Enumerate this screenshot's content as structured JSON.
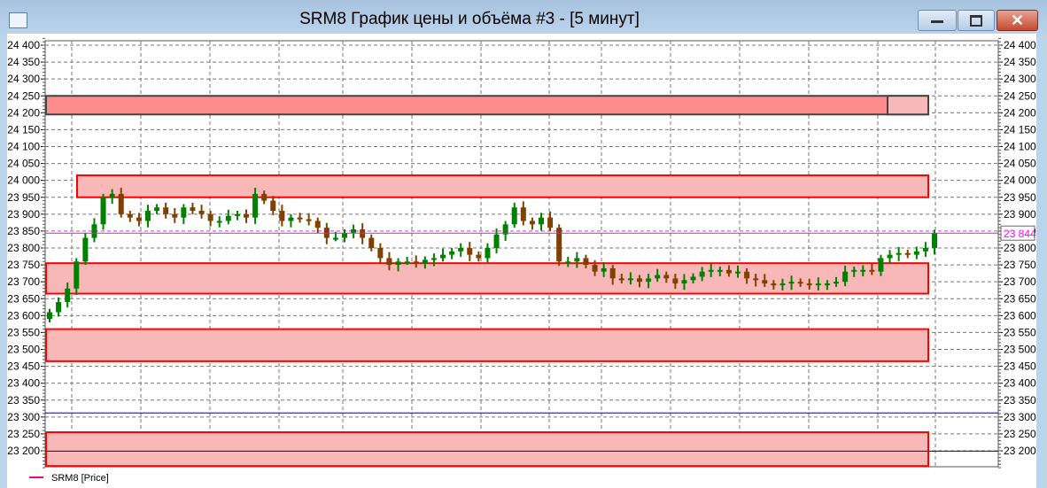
{
  "window": {
    "title": "SRM8 График цены и объёма #3 - [5 минут]"
  },
  "legend": {
    "label": "SRM8 [Price]",
    "color": "#ff0080"
  },
  "colors": {
    "up": "#008000",
    "down": "#804000",
    "zone_fill": "#f9b8b8",
    "zone_fill_dark": "#ff8c8c",
    "zone_border": "#ff0000",
    "price_line": "#ff00ff",
    "level_line": "#0000a0"
  },
  "chart_data": {
    "type": "candlestick",
    "title": "SRM8 График цены и объёма #3 - [5 минут]",
    "ylim": [
      23150,
      24425
    ],
    "yticks": [
      24400,
      24350,
      24300,
      24250,
      24200,
      24150,
      24100,
      24050,
      24000,
      23950,
      23900,
      23850,
      23800,
      23750,
      23700,
      23650,
      23600,
      23550,
      23500,
      23450,
      23400,
      23350,
      23300,
      23250,
      23200
    ],
    "ytick_labels": [
      "24 400",
      "24 350",
      "24 300",
      "24 250",
      "24 200",
      "24 150",
      "24 100",
      "24 050",
      "24 000",
      "23 950",
      "23 900",
      "23 850",
      "23 800",
      "23 750",
      "23 700",
      "23 650",
      "23 600",
      "23 550",
      "23 500",
      "23 450",
      "23 400",
      "23 350",
      "23 300",
      "23 250",
      "23 200"
    ],
    "grid": true,
    "last_price": 23844,
    "last_price_label": "23 844",
    "wick": 10,
    "first_open": 23590,
    "close": [
      23610,
      23640,
      23680,
      23760,
      23830,
      23870,
      23950,
      23960,
      23900,
      23890,
      23880,
      23910,
      23920,
      23900,
      23890,
      23920,
      23910,
      23900,
      23880,
      23880,
      23895,
      23900,
      23890,
      23960,
      23940,
      23910,
      23880,
      23890,
      23885,
      23880,
      23860,
      23830,
      23830,
      23845,
      23855,
      23830,
      23800,
      23770,
      23750,
      23760,
      23760,
      23755,
      23765,
      23770,
      23780,
      23790,
      23800,
      23780,
      23770,
      23800,
      23840,
      23870,
      23920,
      23880,
      23870,
      23890,
      23860,
      23760,
      23760,
      23770,
      23750,
      23730,
      23740,
      23710,
      23705,
      23710,
      23700,
      23710,
      23720,
      23710,
      23695,
      23705,
      23715,
      23730,
      23735,
      23735,
      23725,
      23730,
      23710,
      23705,
      23695,
      23690,
      23695,
      23700,
      23695,
      23690,
      23695,
      23695,
      23700,
      23730,
      23735,
      23735,
      23730,
      23770,
      23780,
      23785,
      23780,
      23790,
      23800,
      23844
    ],
    "zones": [
      {
        "top": 24250,
        "bottom": 24195,
        "style": "dark"
      },
      {
        "top": 24015,
        "bottom": 23950,
        "style": "light",
        "starts_late": true
      },
      {
        "top": 23755,
        "bottom": 23665,
        "style": "light"
      },
      {
        "top": 23560,
        "bottom": 23465,
        "style": "light"
      },
      {
        "top": 23255,
        "bottom": 23155,
        "style": "light"
      }
    ],
    "levels": [
      23312,
      23199
    ]
  }
}
